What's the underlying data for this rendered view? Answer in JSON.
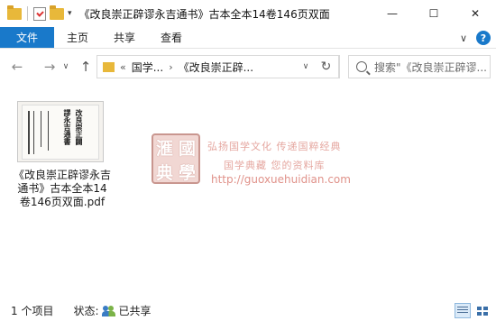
{
  "window": {
    "title": "《改良崇正辟谬永吉通书》古本全本14卷146页双面",
    "minimize": "—",
    "maximize": "☐",
    "close": "✕"
  },
  "ribbon": {
    "tabs": [
      "文件",
      "主页",
      "共享",
      "查看"
    ],
    "expand_glyph": "∨",
    "help_glyph": "?"
  },
  "nav": {
    "back": "←",
    "forward": "→",
    "recent": "∨",
    "up": "↑",
    "breadcrumb_overflow": "«",
    "breadcrumb": [
      "国学...",
      "《改良崇正辟..."
    ],
    "separator": "›",
    "dropdown": "∨",
    "refresh": "↻",
    "search_placeholder": "搜索\"《改良崇正辟谬..."
  },
  "files": [
    {
      "name": "《改良崇正辟谬永吉通书》古本全本14卷146页双面.pdf",
      "thumb_columns": [
        "改良崇正闢",
        "謬永吉通書"
      ],
      "type": "pdf"
    }
  ],
  "watermark": {
    "seal": [
      "滙",
      "國",
      "典",
      "學"
    ],
    "line1": "弘扬国学文化  传递国粹经典",
    "line2": "国学典藏  您的资料库",
    "url": "http://guoxuehuidian.com"
  },
  "status": {
    "count": "1 个项目",
    "state_label": "状态:",
    "state_value": "已共享"
  }
}
